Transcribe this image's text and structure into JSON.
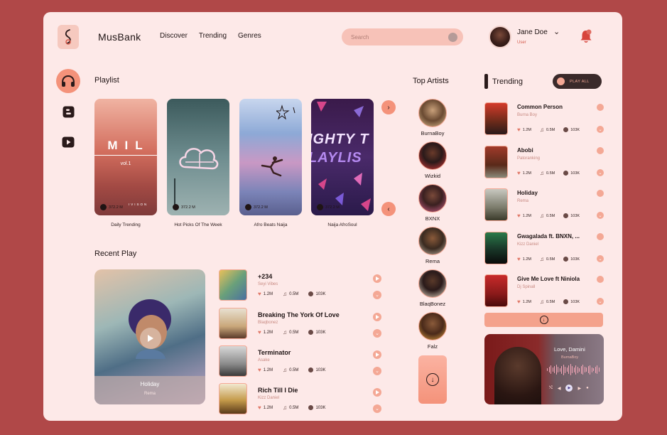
{
  "app": {
    "brand": "MusBank"
  },
  "nav": [
    "Discover",
    "Trending",
    "Genres"
  ],
  "search": {
    "placeholder": "Search"
  },
  "user": {
    "name": "Jane Doe",
    "role": "User"
  },
  "playlist": {
    "title": "Playlist",
    "cards": [
      {
        "label": "Daily Trending",
        "count": "372.2 M",
        "overlay_title": "MIL",
        "overlay_sub": "vol.1",
        "overlay_band": "IVISON"
      },
      {
        "label": "Hot Picks Of The Week",
        "count": "372.2 M"
      },
      {
        "label": "Afro Beats Naija",
        "count": "372.2 M"
      },
      {
        "label": "Naija AfroSoul",
        "count": "372.2 M",
        "overlay_title": "IGHTY T",
        "overlay_sub": "LAYLIS"
      }
    ]
  },
  "recent": {
    "title": "Recent Play",
    "featured": {
      "title": "Holiday",
      "artist": "Rema"
    },
    "items": [
      {
        "title": "+234",
        "artist": "Seyi Vibes",
        "likes": "1.2M",
        "plays": "0.5M",
        "shares": "103K"
      },
      {
        "title": "Breaking The York Of Love",
        "artist": "Blaqbonez",
        "likes": "1.2M",
        "plays": "0.5M",
        "shares": "103K"
      },
      {
        "title": "Terminator",
        "artist": "Asake",
        "likes": "1.2M",
        "plays": "0.5M",
        "shares": "103K"
      },
      {
        "title": "Rich Till I Die",
        "artist": "Kizz Daniel",
        "likes": "1.2M",
        "plays": "0.5M",
        "shares": "103K"
      }
    ]
  },
  "artists": {
    "title": "Top Artists",
    "items": [
      "BurnaBoy",
      "Wizkid",
      "BXNX",
      "Rema",
      "BlaqBonez",
      "Falz"
    ]
  },
  "trending": {
    "title": "Trending",
    "play_all": "PLAY ALL",
    "items": [
      {
        "title": "Common Person",
        "artist": "Burna Boy",
        "likes": "1.2M",
        "plays": "0.5M",
        "shares": "103K"
      },
      {
        "title": "Abobi",
        "artist": "Patoranking",
        "likes": "1.2M",
        "plays": "0.5M",
        "shares": "103K"
      },
      {
        "title": "Holiday",
        "artist": "Rema",
        "likes": "1.2M",
        "plays": "0.5M",
        "shares": "103K"
      },
      {
        "title": "Gwagalada ft. BNXN, ...",
        "artist": "Kizz Daniel",
        "likes": "1.2M",
        "plays": "0.5M",
        "shares": "103K"
      },
      {
        "title": "Give Me Love ft Niniola",
        "artist": "Dj Spinall",
        "likes": "1.2M",
        "plays": "0.5M",
        "shares": "103K"
      }
    ]
  },
  "now_playing": {
    "title": "Love, Damini",
    "artist": "BurnaBoy"
  },
  "colors": {
    "background": "#b04848",
    "panel": "#fde9e8",
    "accent": "#f4927a"
  }
}
